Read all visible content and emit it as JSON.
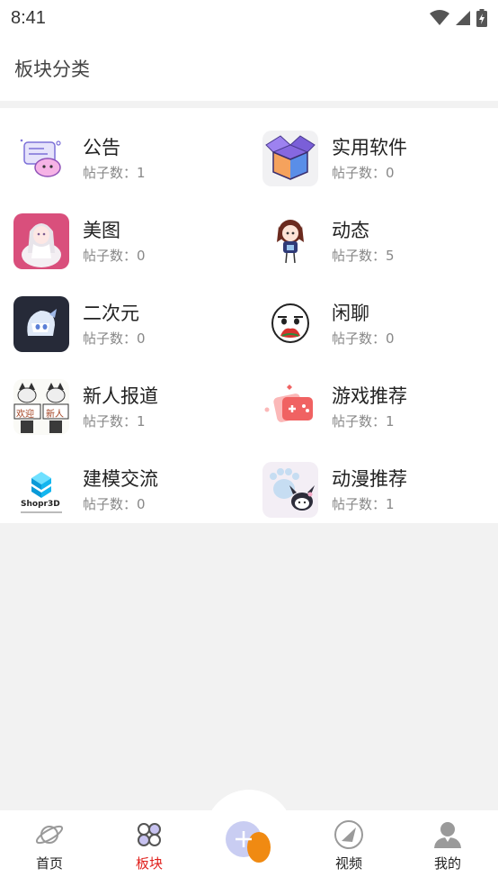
{
  "status_bar": {
    "time": "8:41"
  },
  "header": {
    "title": "板块分类"
  },
  "categories": [
    {
      "name": "公告",
      "count": "帖子数：1"
    },
    {
      "name": "实用软件",
      "count": "帖子数：0"
    },
    {
      "name": "美图",
      "count": "帖子数：0"
    },
    {
      "name": "动态",
      "count": "帖子数：5"
    },
    {
      "name": "二次元",
      "count": "帖子数：0"
    },
    {
      "name": "闲聊",
      "count": "帖子数：0"
    },
    {
      "name": "新人报道",
      "count": "帖子数：1",
      "thumb_text": [
        "欢迎",
        "新人"
      ]
    },
    {
      "name": "游戏推荐",
      "count": "帖子数：1"
    },
    {
      "name": "建模交流",
      "count": "帖子数：0",
      "thumb_text": [
        "Shopr3D"
      ]
    },
    {
      "name": "动漫推荐",
      "count": "帖子数：1"
    }
  ],
  "tabbar": {
    "items": [
      {
        "label": "首页",
        "icon": "planet-icon"
      },
      {
        "label": "板块",
        "icon": "clover-icon",
        "active": true
      },
      {
        "label": "",
        "icon": "plus-icon"
      },
      {
        "label": "视频",
        "icon": "video-icon"
      },
      {
        "label": "我的",
        "icon": "user-icon"
      }
    ]
  },
  "colors": {
    "active_tab": "#e0201c",
    "background": "#f2f2f2",
    "fab_orange": "#f08a12",
    "fab_blue": "#c9cdf2"
  }
}
